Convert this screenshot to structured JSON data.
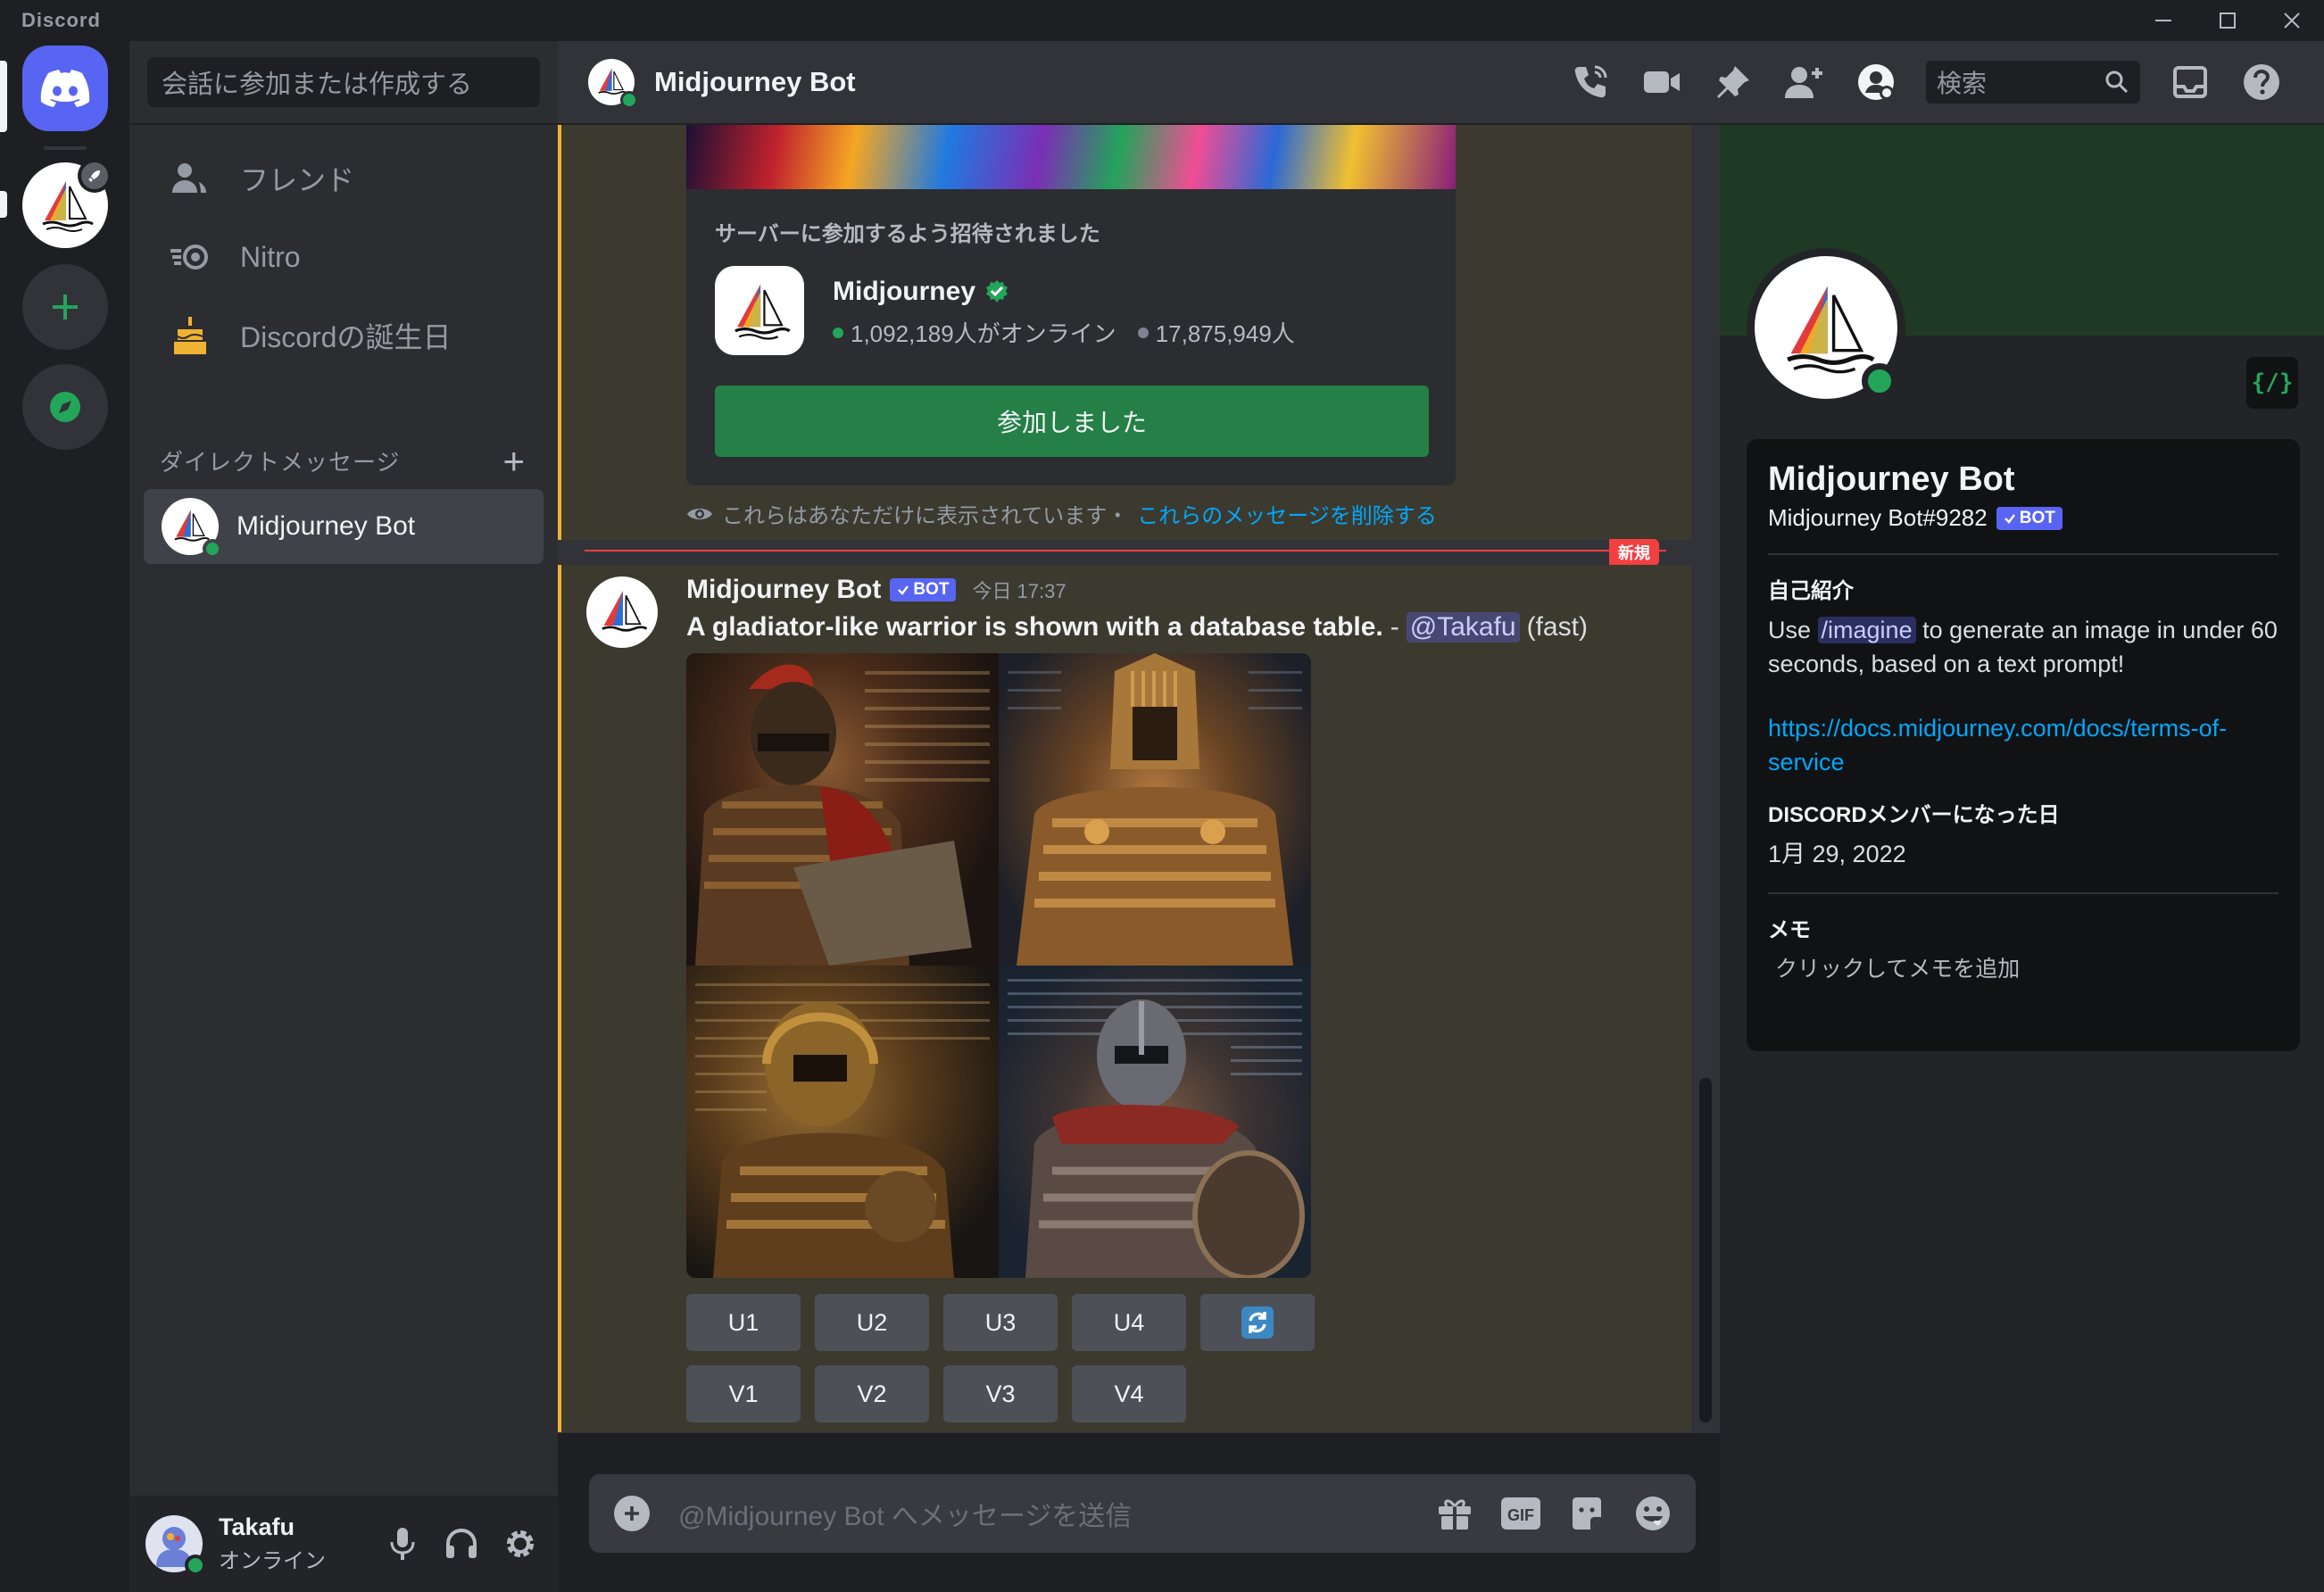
{
  "window": {
    "app_title": "Discord"
  },
  "dm_sidebar": {
    "search_placeholder": "会話に参加または作成する",
    "nav": [
      {
        "label": "フレンド"
      },
      {
        "label": "Nitro"
      },
      {
        "label": "Discordの誕生日"
      }
    ],
    "section_title": "ダイレクトメッセージ",
    "dm_entry": {
      "label": "Midjourney Bot"
    }
  },
  "user": {
    "name": "Takafu",
    "status": "オンライン"
  },
  "header": {
    "title": "Midjourney Bot",
    "search_placeholder": "検索"
  },
  "invite": {
    "heading": "サーバーに参加するよう招待されました",
    "server_name": "Midjourney",
    "online": "1,092,189人がオンライン",
    "members": "17,875,949人",
    "button": "参加しました"
  },
  "ephemeral": {
    "text": "これらはあなただけに表示されています・",
    "link": "これらのメッセージを削除する"
  },
  "new_divider": "新規",
  "message": {
    "author": "Midjourney Bot",
    "bot_tag": "BOT",
    "time": "今日 17:37",
    "prompt": "A gladiator-like warrior is shown with a database table.",
    "dash": "-",
    "mention": "@Takafu",
    "mode": "(fast)"
  },
  "buttons": {
    "row1": [
      "U1",
      "U2",
      "U3",
      "U4"
    ],
    "row2": [
      "V1",
      "V2",
      "V3",
      "V4"
    ]
  },
  "composer": {
    "placeholder": "@Midjourney Bot へメッセージを送信",
    "gif": "GIF"
  },
  "profile": {
    "name": "Midjourney Bot",
    "tag": "Midjourney Bot#9282",
    "bot_tag": "BOT",
    "cmd_icon": "{/}",
    "about_heading": "自己紹介",
    "about_pre": "Use",
    "about_cmd": "/imagine",
    "about_post": "to generate an image in under 60 seconds, based on a text prompt!",
    "link": "https://docs.midjourney.com/docs/terms-of-service",
    "member_heading": "DISCORDメンバーになった日",
    "member_date": "1月 29, 2022",
    "note_heading": "メモ",
    "note_placeholder": "クリックしてメモを追加"
  },
  "colors": {
    "blurple": "#5865f2",
    "green": "#23a55a",
    "join_button": "#248046",
    "highlight_bar": "#f0b232",
    "new_red": "#f23f42",
    "link": "#00a8fc"
  },
  "icons": {
    "titlebar": [
      "minimize-icon",
      "maximize-icon",
      "close-icon"
    ],
    "header": [
      "voice-call-icon",
      "video-call-icon",
      "pin-icon",
      "add-friend-icon",
      "profile-toggle-icon",
      "search-icon",
      "inbox-icon",
      "help-icon"
    ],
    "composer": [
      "gift-icon",
      "gif-icon",
      "sticker-icon",
      "emoji-icon"
    ],
    "user_controls": [
      "mic-icon",
      "headphones-icon",
      "settings-icon"
    ]
  }
}
